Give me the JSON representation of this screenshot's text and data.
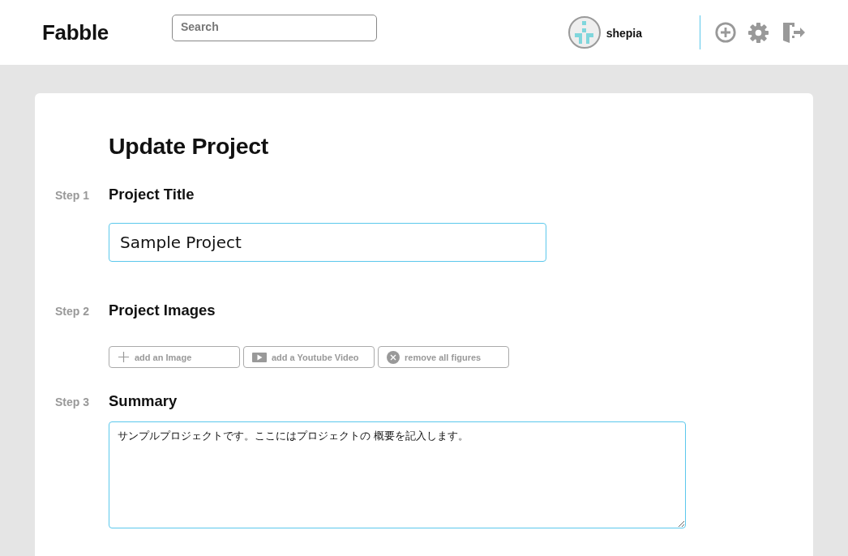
{
  "header": {
    "logo": "Fabble",
    "search": {
      "placeholder": "Search"
    },
    "user": {
      "name": "shepia"
    }
  },
  "page": {
    "title": "Update Project",
    "steps": [
      {
        "label": "Step 1",
        "heading": "Project Title",
        "kind": "text",
        "value": "Sample Project"
      },
      {
        "label": "Step 2",
        "heading": "Project Images",
        "kind": "media",
        "buttons": [
          {
            "kind": "image",
            "label": "add an Image"
          },
          {
            "kind": "video",
            "label": "add a Youtube Video"
          },
          {
            "kind": "remove",
            "label": "remove all figures"
          }
        ]
      },
      {
        "label": "Step 3",
        "heading": "Summary",
        "kind": "textarea",
        "value": "サンプルプロジェクトです。ここにはプロジェクトの 概要を記入します。"
      }
    ]
  }
}
